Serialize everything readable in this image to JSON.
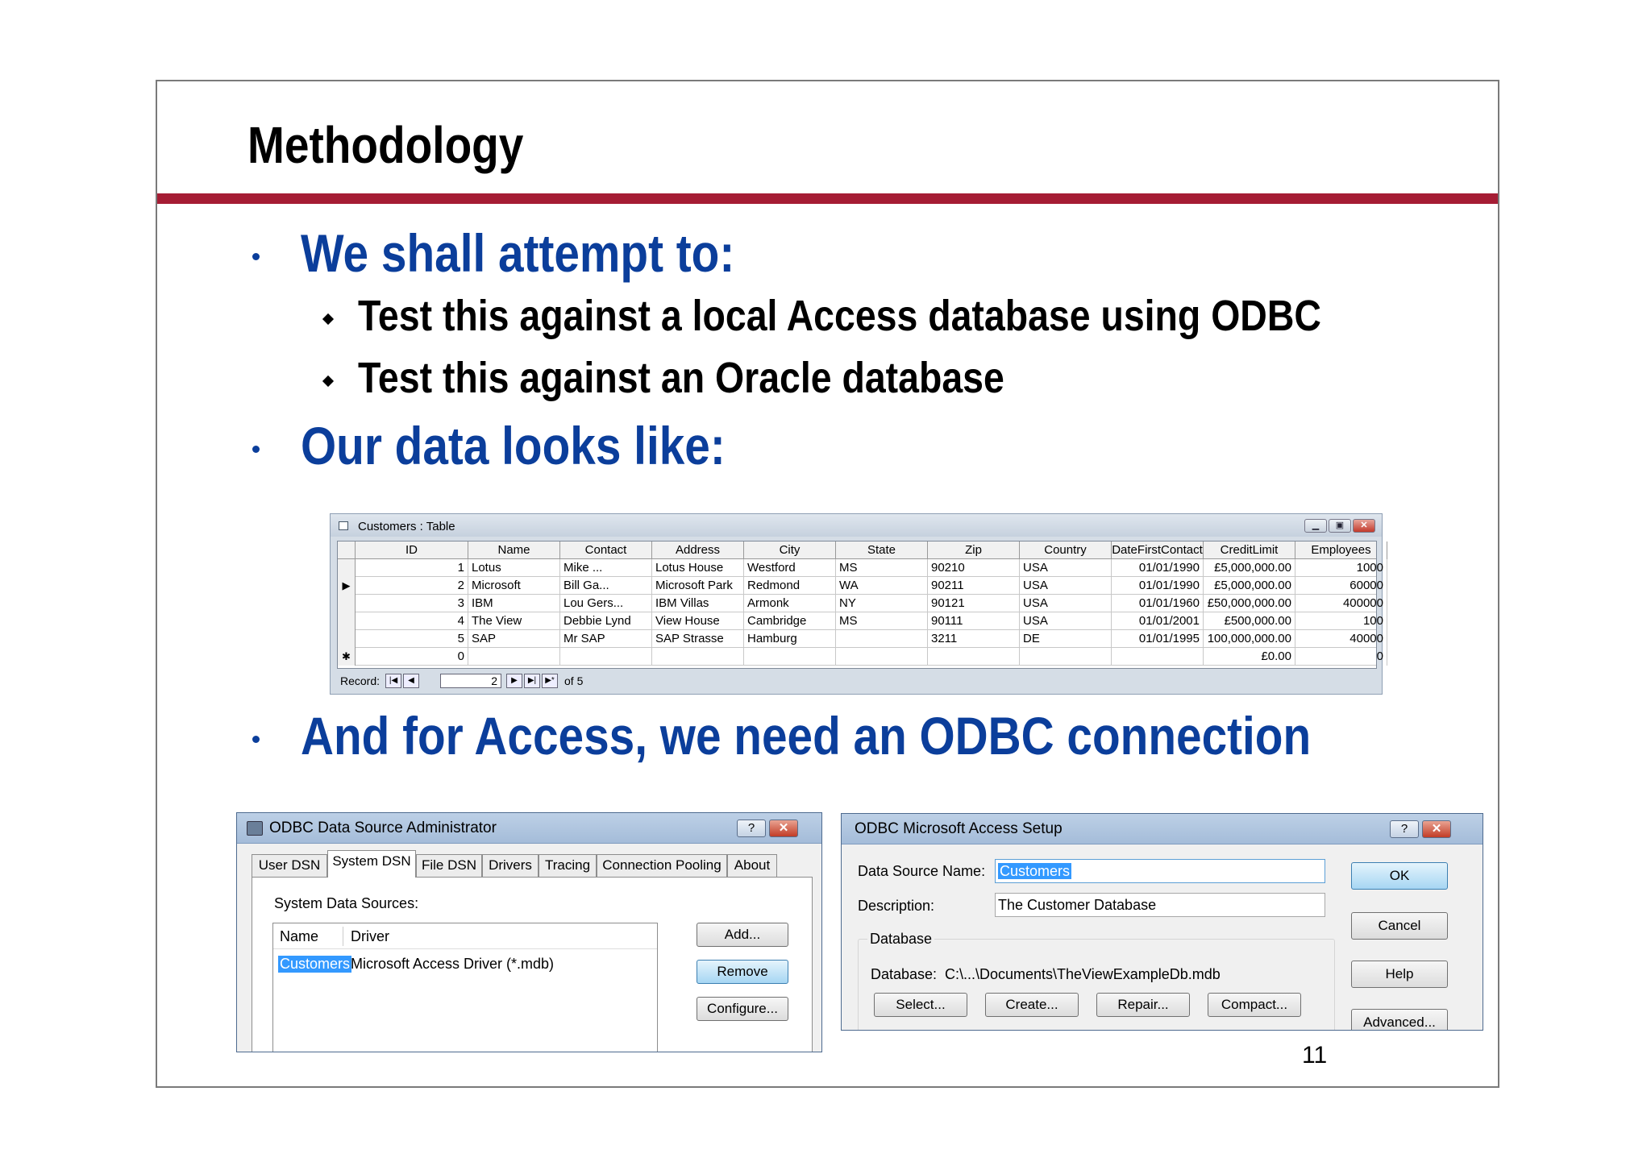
{
  "slide": {
    "title": "Methodology",
    "bullets": [
      "We shall attempt to:",
      "Test this against a local Access database using ODBC",
      "Test this against an Oracle database",
      "Our data looks like:",
      "And for Access, we need an ODBC connection"
    ],
    "page_number": "11"
  },
  "access_table": {
    "title": "Customers : Table",
    "columns": [
      "ID",
      "Name",
      "Contact",
      "Address",
      "City",
      "State",
      "Zip",
      "Country",
      "DateFirstContact",
      "CreditLimit",
      "Employees"
    ],
    "rows": [
      [
        "1",
        "Lotus",
        "Mike ...",
        "Lotus House",
        "Westford",
        "MS",
        "90210",
        "USA",
        "01/01/1990",
        "£5,000,000.00",
        "1000"
      ],
      [
        "2",
        "Microsoft",
        "Bill Ga...",
        "Microsoft Park",
        "Redmond",
        "WA",
        "90211",
        "USA",
        "01/01/1990",
        "£5,000,000.00",
        "60000"
      ],
      [
        "3",
        "IBM",
        "Lou Gers...",
        "IBM Villas",
        "Armonk",
        "NY",
        "90121",
        "USA",
        "01/01/1960",
        "£50,000,000.00",
        "400000"
      ],
      [
        "4",
        "The View",
        "Debbie Lynd",
        "View House",
        "Cambridge",
        "MS",
        "90111",
        "USA",
        "01/01/2001",
        "£500,000.00",
        "100"
      ],
      [
        "5",
        "SAP",
        "Mr SAP",
        "SAP Strasse",
        "Hamburg",
        "",
        "3211",
        "DE",
        "01/01/1995",
        "100,000,000.00",
        "40000"
      ],
      [
        "0",
        "",
        "",
        "",
        "",
        "",
        "",
        "",
        "",
        "£0.00",
        "0"
      ]
    ],
    "record_label": "Record:",
    "record_current": "2",
    "record_of": "of 5"
  },
  "odbc_admin": {
    "title": "ODBC Data Source Administrator",
    "tabs": [
      "User DSN",
      "System DSN",
      "File DSN",
      "Drivers",
      "Tracing",
      "Connection Pooling",
      "About"
    ],
    "section_label": "System Data Sources:",
    "list_headers": [
      "Name",
      "Driver"
    ],
    "list_row": {
      "name": "Customers",
      "driver": "Microsoft Access Driver (*.mdb)"
    },
    "buttons": {
      "add": "Add...",
      "remove": "Remove",
      "configure": "Configure..."
    },
    "help_btn": "?",
    "close_btn": "✕"
  },
  "odbc_setup": {
    "title": "ODBC Microsoft Access Setup",
    "dsn_label": "Data Source Name:",
    "dsn_value": "Customers",
    "desc_label": "Description:",
    "desc_value": "The Customer Database",
    "group_label": "Database",
    "db_label": "Database:",
    "db_path": "C:\\...\\Documents\\TheViewExampleDb.mdb",
    "buttons": {
      "select": "Select...",
      "create": "Create...",
      "repair": "Repair...",
      "compact": "Compact...",
      "ok": "OK",
      "cancel": "Cancel",
      "help": "Help",
      "advanced": "Advanced..."
    },
    "help_btn": "?",
    "close_btn": "✕"
  }
}
